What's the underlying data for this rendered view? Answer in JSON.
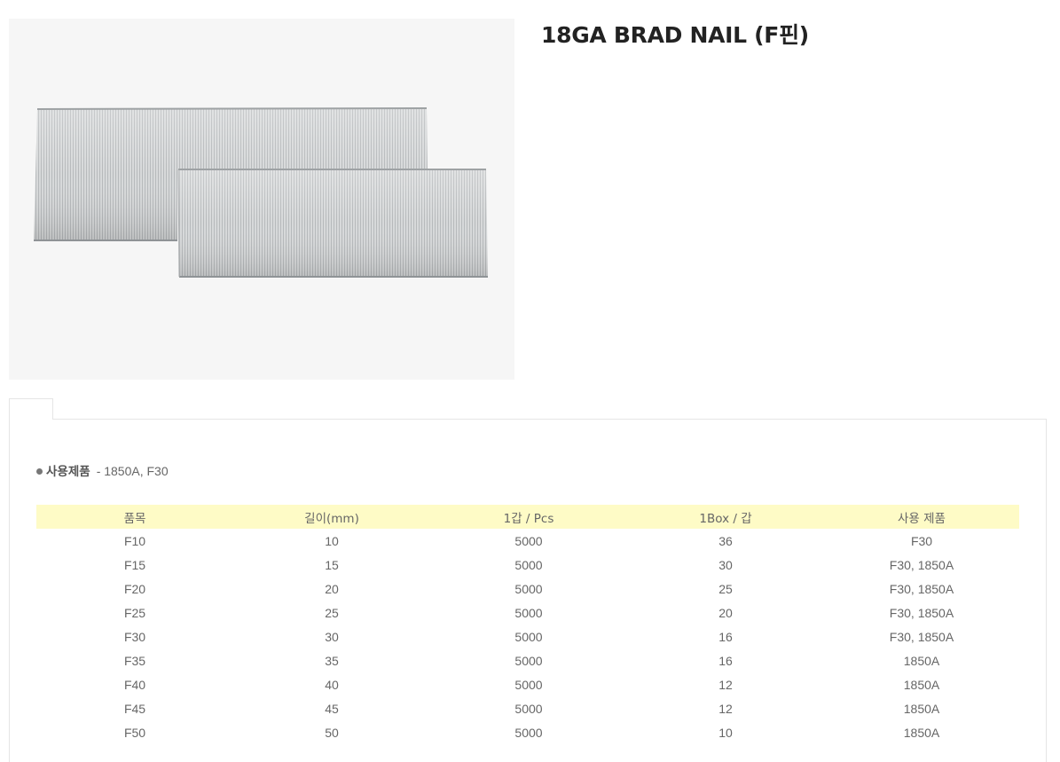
{
  "product": {
    "title": "18GA BRAD NAIL (F핀)",
    "image_alt": "brad-nail-strips-image"
  },
  "usage": {
    "label": "사용제품",
    "value": "- 1850A, F30"
  },
  "table": {
    "headers": [
      "품목",
      "길이(mm)",
      "1갑 / Pcs",
      "1Box / 갑",
      "사용 제품"
    ],
    "rows": [
      [
        "F10",
        "10",
        "5000",
        "36",
        "F30"
      ],
      [
        "F15",
        "15",
        "5000",
        "30",
        "F30, 1850A"
      ],
      [
        "F20",
        "20",
        "5000",
        "25",
        "F30, 1850A"
      ],
      [
        "F25",
        "25",
        "5000",
        "20",
        "F30, 1850A"
      ],
      [
        "F30",
        "30",
        "5000",
        "16",
        "F30, 1850A"
      ],
      [
        "F35",
        "35",
        "5000",
        "16",
        "1850A"
      ],
      [
        "F40",
        "40",
        "5000",
        "12",
        "1850A"
      ],
      [
        "F45",
        "45",
        "5000",
        "12",
        "1850A"
      ],
      [
        "F50",
        "50",
        "5000",
        "10",
        "1850A"
      ]
    ]
  },
  "colors": {
    "header_bg": "#fefbc6",
    "image_bg": "#f6f6f6",
    "border": "#e5e5e5"
  }
}
